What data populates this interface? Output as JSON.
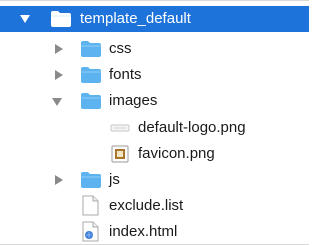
{
  "tree": {
    "root": {
      "label": "template_default",
      "expanded": true,
      "selected": true,
      "icon": "folder-icon"
    },
    "items": [
      {
        "label": "css",
        "icon": "folder-icon",
        "kind": "folder",
        "expanded": false
      },
      {
        "label": "fonts",
        "icon": "folder-icon",
        "kind": "folder",
        "expanded": false
      },
      {
        "label": "images",
        "icon": "folder-icon",
        "kind": "folder",
        "expanded": true
      },
      {
        "label": "default-logo.png",
        "icon": "png-image-icon",
        "kind": "file"
      },
      {
        "label": "favicon.png",
        "icon": "image-preview-icon",
        "kind": "file"
      },
      {
        "label": "js",
        "icon": "folder-icon",
        "kind": "folder",
        "expanded": false
      },
      {
        "label": "exclude.list",
        "icon": "document-icon",
        "kind": "file"
      },
      {
        "label": "index.html",
        "icon": "html-file-icon",
        "kind": "file"
      }
    ]
  },
  "colors": {
    "selection": "#1d73d9",
    "folder": "#5db3f0",
    "disclosure": "#8a8a8a"
  }
}
